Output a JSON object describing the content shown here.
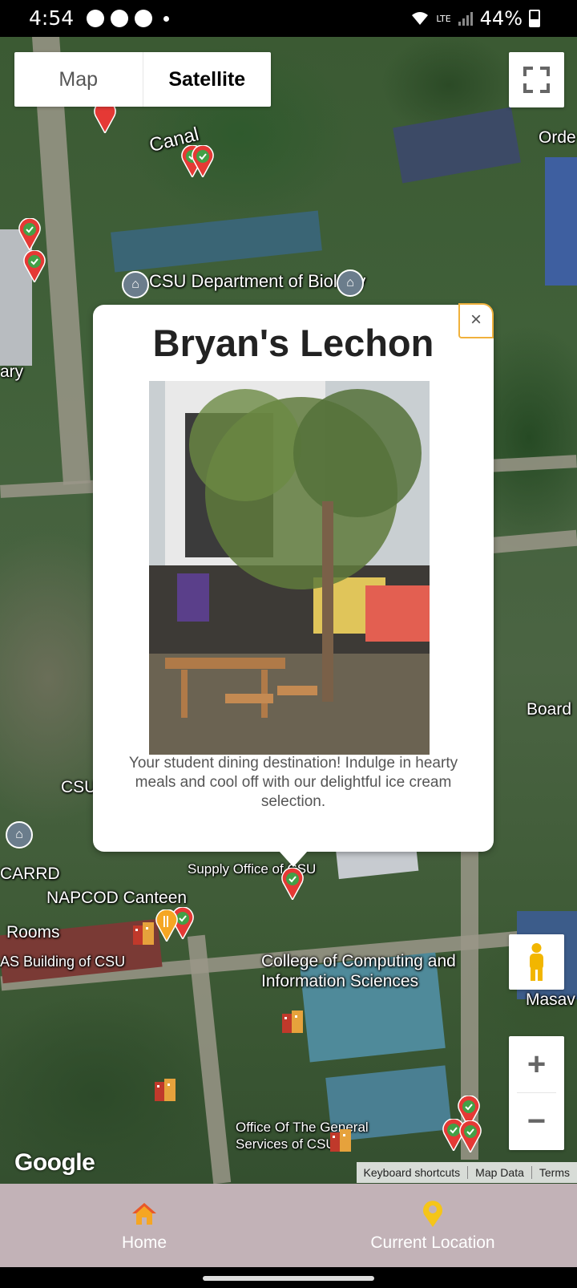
{
  "status_bar": {
    "time": "4:54",
    "network": "LTE",
    "battery": "44%"
  },
  "map": {
    "type_control": {
      "map_label": "Map",
      "satellite_label": "Satellite",
      "selected": "Satellite"
    },
    "labels": {
      "canal": "Canal",
      "csu_biology": "CSU Department of Biology",
      "library_partial": "ary",
      "order_partial": "Orde",
      "board_partial": "Board",
      "csu_partial": "CSU",
      "carrd": "CARRD",
      "napcod": "NAPCOD Canteen",
      "rooms": "Rooms",
      "cas_building": "AS Building of CSU",
      "supply_office": "Supply Office of CSU",
      "ccis": "College of Computing and Information Sciences",
      "masav_partial": "Masav",
      "gso": "Office Of The General Services of CSU"
    },
    "google_logo": "Google",
    "attribution": [
      "Keyboard shortcuts",
      "Map Data",
      "Terms"
    ],
    "zoom_in_label": "+",
    "zoom_out_label": "−"
  },
  "popup": {
    "title": "Bryan's Lechon",
    "close_label": "×",
    "description": "Your student dining destination! Indulge in hearty meals and cool off with our delightful ice cream selection."
  },
  "bottom_nav": {
    "home_label": "Home",
    "location_label": "Current Location",
    "home_icon": "home-icon",
    "location_icon": "location-pin-icon",
    "icon_color": "#f5a623"
  }
}
